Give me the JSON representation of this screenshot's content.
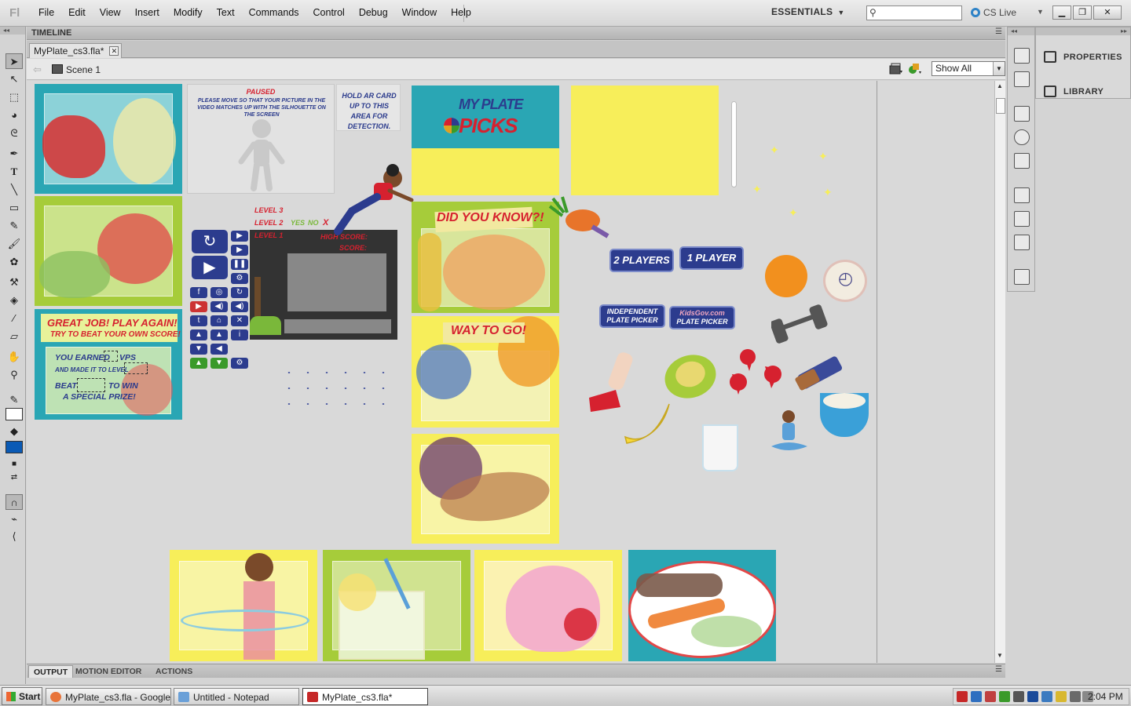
{
  "app": {
    "logo": "Fl",
    "menu": [
      "File",
      "Edit",
      "View",
      "Insert",
      "Modify",
      "Text",
      "Commands",
      "Control",
      "Debug",
      "Window",
      "Help"
    ],
    "workspace": "ESSENTIALS",
    "search_placeholder": "",
    "cs_live": "CS Live"
  },
  "panels": {
    "timeline_label": "TIMELINE",
    "doc_tab": "MyPlate_cs3.fla*",
    "scene": "Scene 1",
    "zoom": "Show All",
    "bottom_tabs": [
      "OUTPUT",
      "MOTION EDITOR",
      "ACTIONS"
    ],
    "right_panel": [
      "PROPERTIES",
      "LIBRARY"
    ]
  },
  "stage": {
    "paused_title": "PAUSED",
    "paused_msg": "PLEASE MOVE SO THAT YOUR PICTURE IN THE VIDEO MATCHES UP WITH THE SILHOUETTE ON THE SCREEN",
    "hold_card": "HOLD AR CARD UP TO THIS AREA FOR DETECTION.",
    "logo_line1": "MY PLATE",
    "logo_line2": "PICKS",
    "level3": "LEVEL 3",
    "level2": "LEVEL 2",
    "level1": "LEVEL 1",
    "yes": "YES",
    "no": "NO",
    "x_mark": "X",
    "high_score": "HIGH SCORE:",
    "score": "SCORE:",
    "did_you_know": "DID YOU KNOW?!",
    "way_to_go": "WAY TO GO!",
    "great_job": "GREAT JOB! PLAY AGAIN!",
    "beat_score": "TRY TO BEAT YOUR OWN SCORE!",
    "you_earned": "YOU EARNED",
    "vps": "VPS",
    "made_level": "AND MADE IT TO LEVEL",
    "beat": "BEAT",
    "to_win": "TO WIN",
    "special_prize": "A SPECIAL PRIZE!",
    "two_players": "2 PLAYERS",
    "one_player": "1 PLAYER",
    "independent_1": "INDEPENDENT",
    "independent_2": "PLATE PICKER",
    "kidsgov": "KidsGov.com",
    "plate_picker": "PLATE PICKER"
  },
  "taskbar": {
    "start": "Start",
    "items": [
      "MyPlate_cs3.fla - Google...",
      "Untitled - Notepad",
      "MyPlate_cs3.fla*"
    ],
    "clock": "2:04 PM"
  },
  "colors": {
    "accent_blue": "#2c3c8e",
    "lime": "#a6cc3a",
    "teal": "#2aa6b4",
    "yellow": "#f7ee5a",
    "red_text": "#d6212f"
  }
}
